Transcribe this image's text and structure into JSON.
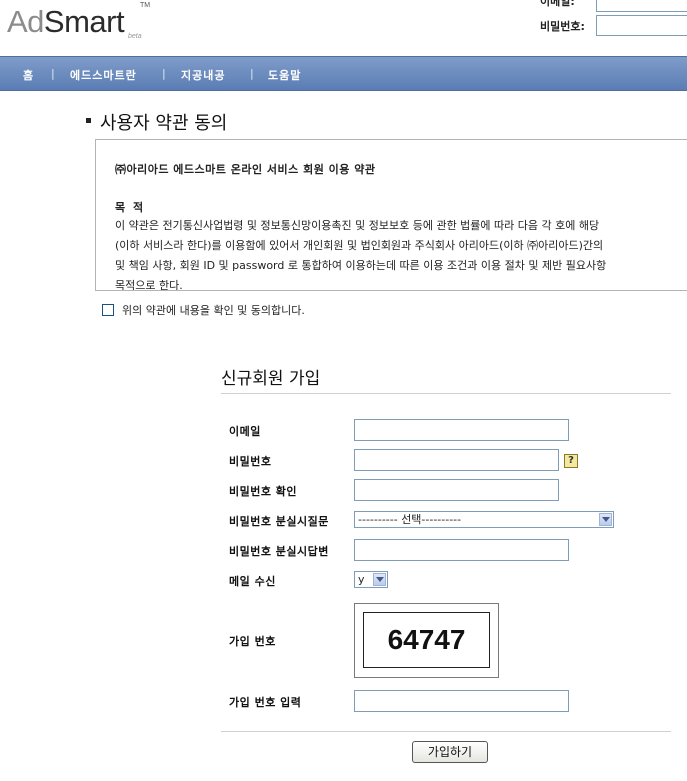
{
  "brand": {
    "logo_ad": "Ad",
    "logo_smart": "Smart",
    "logo_tm": "TM",
    "logo_beta": "beta"
  },
  "login": {
    "email_label": "이메일:",
    "password_label": "비밀번호:"
  },
  "nav": {
    "items": [
      "홈",
      "에드스마트란",
      "지공내공",
      "도움말"
    ],
    "separator": "|",
    "bar_color": "#6b8ac0"
  },
  "terms": {
    "section_title": "사용자 약관 동의",
    "heading": "㈜아리아드 에드스마트 온라인 서비스 회원 이용 약관",
    "purpose_title": "목 적",
    "lines": [
      "이 약관은 전기통신사업법령 및 정보통신망이용촉진 및 정보보호 등에 관한 법률에 따라 다음 각 호에 해당",
      "(이하 서비스라 한다)를 이용함에 있어서 개인회원 및 법인회원과 주식회사 아리아드(이하 ㈜아리아드)간의",
      "및 책임 사항, 회원 ID 및 password 로 통합하여 이용하는데 따른 이용 조건과 이용 절차 및 제반 필요사항",
      "목적으로 한다."
    ],
    "agree_label": "위의 약관에 내용을 확인 및 동의합니다."
  },
  "registration": {
    "title": "신규회원 가입",
    "fields": {
      "email": "이메일",
      "password": "비밀번호",
      "password_confirm": "비밀번호 확인",
      "lost_question": "비밀번호 분실시질문",
      "lost_answer": "비밀번호 분실시답변",
      "mail_receive": "메일 수신",
      "signup_number": "가입 번호",
      "signup_number_input": "가입 번호 입력"
    },
    "help_glyph": "?",
    "question_select_value": "---------- 선택----------",
    "mail_select_value": "y",
    "captcha_code": "64747",
    "submit_label": "가입하기"
  }
}
